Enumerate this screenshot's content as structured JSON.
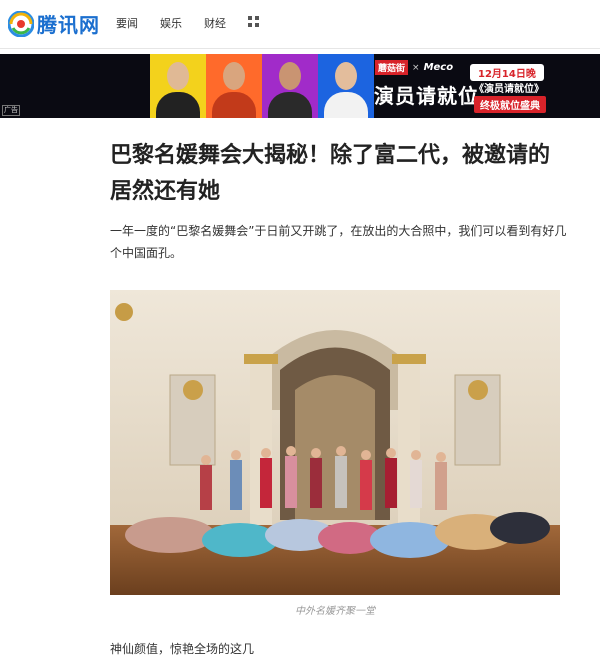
{
  "brand": {
    "site_name": "腾讯网",
    "logo_icon": "tencent-logo-icon"
  },
  "nav": {
    "items": [
      "要闻",
      "娱乐",
      "财经"
    ],
    "more_icon": "grid-icon"
  },
  "ad": {
    "tag": "广告",
    "brand1": "蘑菇街",
    "brand_x": "×",
    "brand2": "Meco",
    "date": "12月14日晚",
    "main_title": "演员请就位",
    "show_title": "《演员请就位》",
    "show_sub": "终极就位盛典"
  },
  "article": {
    "title": "巴黎名媛舞会大揭秘！除了富二代，被邀请的居然还有她",
    "lead": "一年一度的“巴黎名媛舞会”于日前又开跳了，在放出的大合照中，我们可以看到有好几个中国面孔。",
    "image_caption": "中外名媛齐聚一堂",
    "next_paragraph": "神仙颜值，惊艳全场的这几"
  },
  "colors": {
    "accent": "#1b6fcf",
    "ad_red": "#d8232a"
  }
}
